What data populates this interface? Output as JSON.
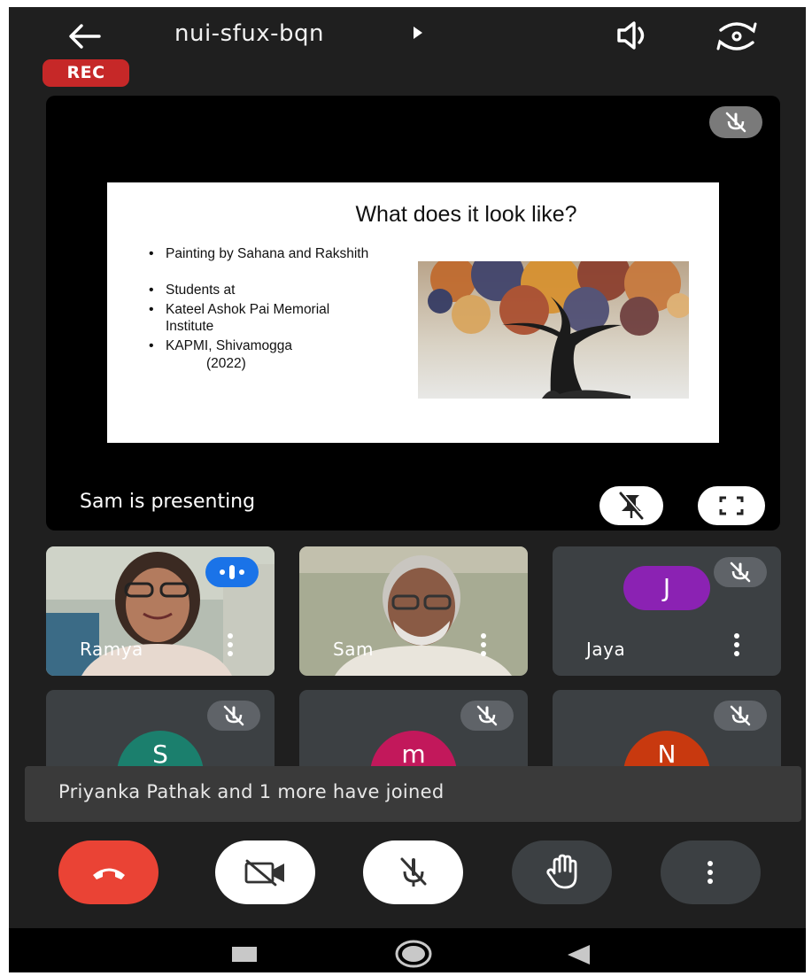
{
  "header": {
    "meeting_code": "nui-sfux-bqn",
    "recording_badge": "REC"
  },
  "icons": {
    "back": "arrow-left-icon",
    "meeting_info": "caret-right-icon",
    "audio_output": "speaker-icon",
    "switch_camera": "camera-switch-icon"
  },
  "presentation": {
    "presenter_label": "Sam is presenting",
    "slide": {
      "title": "What does it look like?",
      "bullets": [
        "Painting by Sahana and Rakshith",
        "Students at",
        "Kateel Ashok Pai Memorial Institute",
        "KAPMI, Shivamogga"
      ],
      "bullet_tail": "(2022)"
    }
  },
  "participants": [
    {
      "name": "Ramya",
      "type": "video",
      "speaking": true
    },
    {
      "name": "Sam",
      "type": "video",
      "speaking": false
    },
    {
      "name": "Jaya",
      "type": "avatar",
      "initial": "J",
      "color": "#8b22b3",
      "muted": true
    },
    {
      "name": "",
      "type": "avatar",
      "initial": "S",
      "color": "#1b7f6d",
      "muted": true
    },
    {
      "name": "",
      "type": "avatar",
      "initial": "m",
      "color": "#c2185b",
      "muted": true
    },
    {
      "name": "",
      "type": "avatar",
      "initial": "N",
      "color": "#c8390f",
      "muted": true
    }
  ],
  "toast": {
    "message": "Priyanka Pathak and 1 more have joined"
  },
  "controls": [
    {
      "name": "end-call",
      "icon": "phone-hangup-icon",
      "color": "#ea4335"
    },
    {
      "name": "camera",
      "icon": "video-off-icon",
      "color": "#ffffff"
    },
    {
      "name": "microphone",
      "icon": "mic-off-icon",
      "color": "#ffffff"
    },
    {
      "name": "raise-hand",
      "icon": "hand-icon",
      "color": "#3c4043"
    },
    {
      "name": "more-options",
      "icon": "more-vert-icon",
      "color": "#3c4043"
    }
  ],
  "colors": {
    "background": "#1f1f1f",
    "tile": "#3c4043",
    "recording": "#c62828",
    "speaking_indicator": "#1a73e8"
  }
}
